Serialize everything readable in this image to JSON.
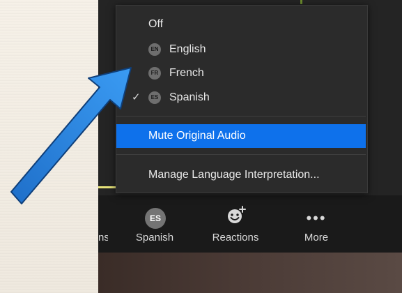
{
  "menu": {
    "items": [
      {
        "label": "Off"
      },
      {
        "label": "English",
        "badge": "EN"
      },
      {
        "label": "French",
        "badge": "FR"
      },
      {
        "label": "Spanish",
        "badge": "ES",
        "checked": true
      }
    ],
    "mute_label": "Mute Original Audio",
    "manage_label": "Manage Language Interpretation..."
  },
  "toolbar": {
    "partial_label": "ns",
    "spanish_badge": "ES",
    "spanish_label": "Spanish",
    "reactions_label": "Reactions",
    "more_dots": "•••",
    "more_label": "More"
  },
  "colors": {
    "accent": "#0e71eb",
    "arrow": "#2b8ae6"
  }
}
